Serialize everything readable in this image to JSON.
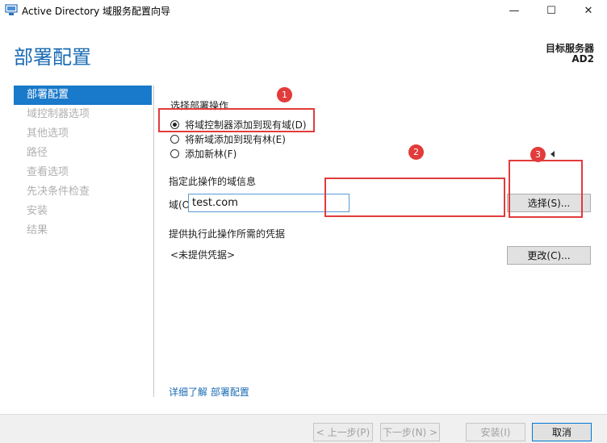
{
  "window": {
    "title": "Active Directory 域服务配置向导",
    "minimize_glyph": "—",
    "maximize_glyph": "☐",
    "close_glyph": "✕"
  },
  "header": {
    "page_title": "部署配置",
    "target_label": "目标服务器",
    "target_name": "AD2"
  },
  "sidebar": {
    "items": [
      {
        "label": "部署配置",
        "active": true
      },
      {
        "label": "域控制器选项",
        "active": false
      },
      {
        "label": "其他选项",
        "active": false
      },
      {
        "label": "路径",
        "active": false
      },
      {
        "label": "查看选项",
        "active": false
      },
      {
        "label": "先决条件检查",
        "active": false
      },
      {
        "label": "安装",
        "active": false
      },
      {
        "label": "结果",
        "active": false
      }
    ]
  },
  "content": {
    "operation_label": "选择部署操作",
    "options": [
      {
        "label": "将域控制器添加到现有域(D)",
        "selected": true
      },
      {
        "label": "将新域添加到现有林(E)",
        "selected": false
      },
      {
        "label": "添加新林(F)",
        "selected": false
      }
    ],
    "domain_info_label": "指定此操作的域信息",
    "domain_field_label": "域(O):",
    "domain_value": "test.com",
    "select_button": "选择(S)...",
    "credentials_label": "提供执行此操作所需的凭据",
    "credentials_value": "<未提供凭据>",
    "change_button": "更改(C)...",
    "learn_more_link": "详细了解 部署配置"
  },
  "footer": {
    "back_button": "< 上一步(P)",
    "next_button": "下一步(N) >",
    "install_button": "安装(I)",
    "cancel_button": "取消"
  },
  "annotations": {
    "badges": [
      "1",
      "2",
      "3"
    ],
    "color": "#e23b3b"
  },
  "colors": {
    "accent": "#1979ca",
    "title_blue": "#1a6bb3"
  }
}
